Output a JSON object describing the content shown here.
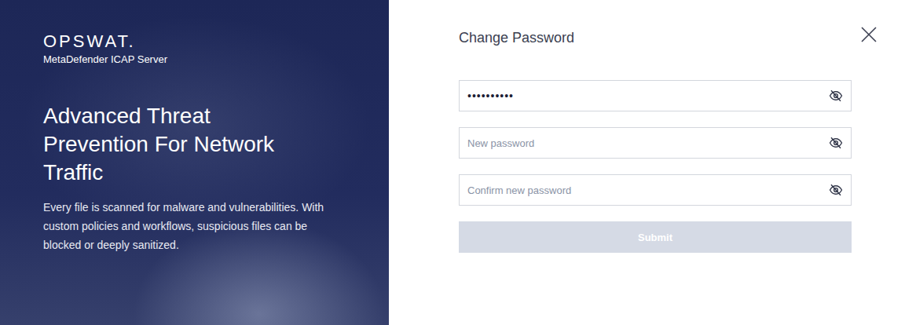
{
  "brand": {
    "logo": "OPSWAT.",
    "product": "MetaDefender ICAP Server"
  },
  "hero": {
    "title": "Advanced Threat Prevention For Network Traffic",
    "description": "Every file is scanned for malware and vulnerabilities. With custom policies and workflows, suspicious files can be blocked or deeply sanitized."
  },
  "dialog": {
    "title": "Change Password",
    "fields": [
      {
        "value": "••••••••••",
        "masked": true
      },
      {
        "placeholder": "New password",
        "value": "",
        "masked": true
      },
      {
        "placeholder": "Confirm new password",
        "value": "",
        "masked": true
      }
    ],
    "submit": {
      "label": "Submit",
      "disabled": true
    }
  }
}
